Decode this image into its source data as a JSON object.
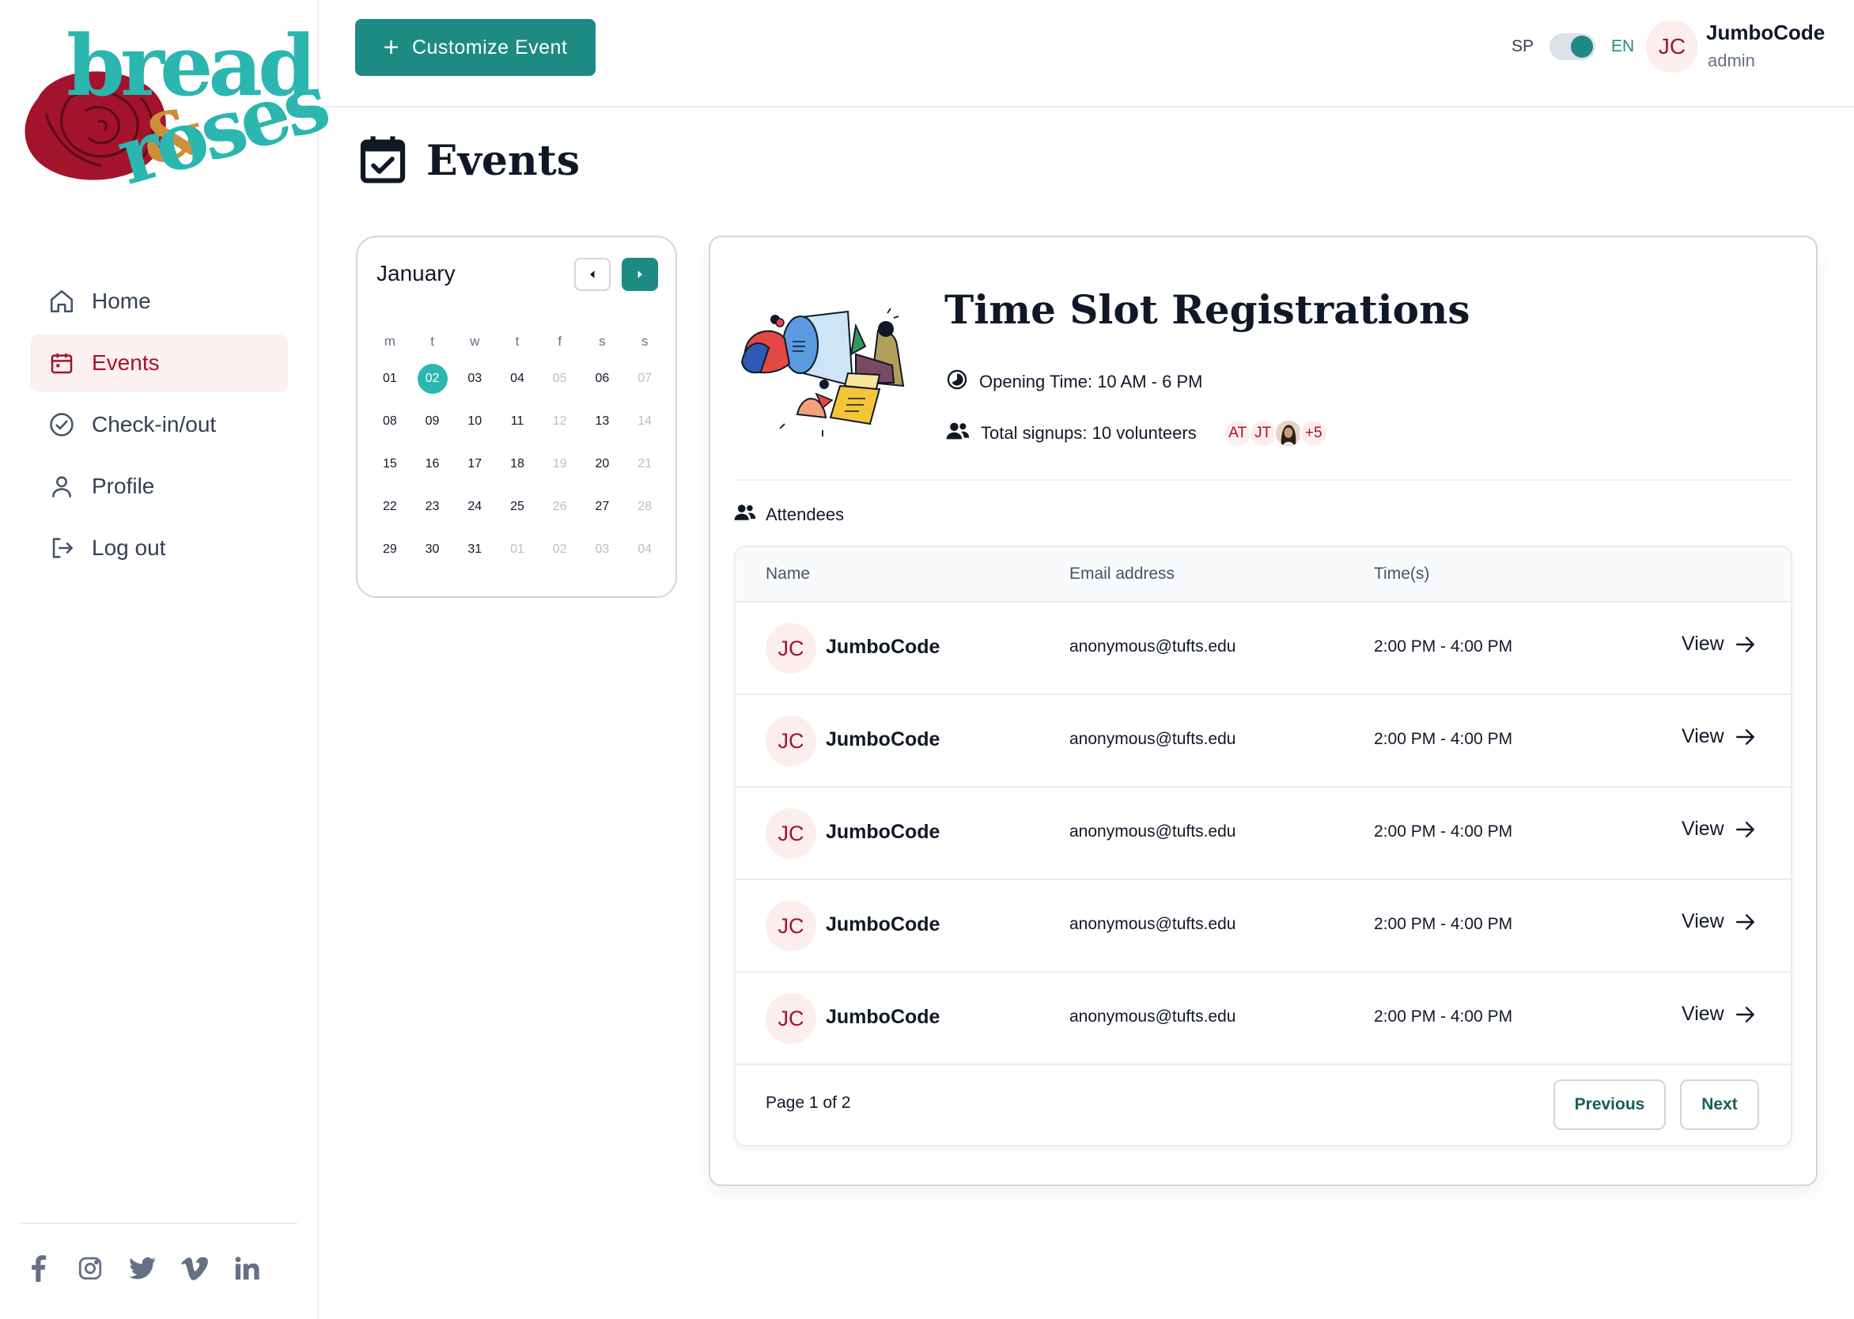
{
  "brand": {
    "logo_word1": "bread",
    "logo_amp": "&",
    "logo_word2": "roses",
    "colors": {
      "teal": "#2bb6b0",
      "dark_teal": "#1d8a84",
      "crimson": "#a3132c",
      "gold": "#d18e3a"
    }
  },
  "sidebar": {
    "items": [
      {
        "label": "Home",
        "icon": "home-icon",
        "active": false
      },
      {
        "label": "Events",
        "icon": "calendar-icon",
        "active": true
      },
      {
        "label": "Check-in/out",
        "icon": "check-circle-icon",
        "active": false
      },
      {
        "label": "Profile",
        "icon": "user-icon",
        "active": false
      },
      {
        "label": "Log out",
        "icon": "logout-icon",
        "active": false
      }
    ],
    "social": [
      "facebook-icon",
      "instagram-icon",
      "twitter-icon",
      "vimeo-icon",
      "linkedin-icon"
    ]
  },
  "header": {
    "customize_label": "Customize Event",
    "lang_left": "SP",
    "lang_right": "EN",
    "user_initials": "JC",
    "user_name": "JumboCode",
    "user_role": "admin"
  },
  "page": {
    "title": "Events"
  },
  "calendar": {
    "month": "January",
    "weekdays": [
      "m",
      "t",
      "w",
      "t",
      "f",
      "s",
      "s"
    ],
    "weeks": [
      [
        {
          "d": "01"
        },
        {
          "d": "02",
          "sel": true
        },
        {
          "d": "03"
        },
        {
          "d": "04"
        },
        {
          "d": "05",
          "m": true
        },
        {
          "d": "06"
        },
        {
          "d": "07",
          "m": true
        }
      ],
      [
        {
          "d": "08"
        },
        {
          "d": "09"
        },
        {
          "d": "10"
        },
        {
          "d": "11"
        },
        {
          "d": "12",
          "m": true
        },
        {
          "d": "13"
        },
        {
          "d": "14",
          "m": true
        }
      ],
      [
        {
          "d": "15"
        },
        {
          "d": "16"
        },
        {
          "d": "17"
        },
        {
          "d": "18"
        },
        {
          "d": "19",
          "m": true
        },
        {
          "d": "20"
        },
        {
          "d": "21",
          "m": true
        }
      ],
      [
        {
          "d": "22"
        },
        {
          "d": "23"
        },
        {
          "d": "24"
        },
        {
          "d": "25"
        },
        {
          "d": "26",
          "m": true
        },
        {
          "d": "27"
        },
        {
          "d": "28",
          "m": true
        }
      ],
      [
        {
          "d": "29"
        },
        {
          "d": "30"
        },
        {
          "d": "31"
        },
        {
          "d": "01",
          "m": true
        },
        {
          "d": "02",
          "m": true
        },
        {
          "d": "03",
          "m": true
        },
        {
          "d": "04",
          "m": true
        }
      ]
    ]
  },
  "event": {
    "title": "Time Slot Registrations",
    "opening_time": "Opening Time: 10 AM - 6 PM",
    "total_signups": "Total signups: 10 volunteers",
    "avatar_1": "AT",
    "avatar_2": "JT",
    "avatar_more": "+5",
    "attendees_label": "Attendees"
  },
  "table": {
    "headers": {
      "name": "Name",
      "email": "Email address",
      "times": "Time(s)"
    },
    "rows": [
      {
        "initials": "JC",
        "name": "JumboCode",
        "email": "anonymous@tufts.edu",
        "time": "2:00 PM - 4:00 PM",
        "action": "View"
      },
      {
        "initials": "JC",
        "name": "JumboCode",
        "email": "anonymous@tufts.edu",
        "time": "2:00 PM - 4:00 PM",
        "action": "View"
      },
      {
        "initials": "JC",
        "name": "JumboCode",
        "email": "anonymous@tufts.edu",
        "time": "2:00 PM - 4:00 PM",
        "action": "View"
      },
      {
        "initials": "JC",
        "name": "JumboCode",
        "email": "anonymous@tufts.edu",
        "time": "2:00 PM - 4:00 PM",
        "action": "View"
      },
      {
        "initials": "JC",
        "name": "JumboCode",
        "email": "anonymous@tufts.edu",
        "time": "2:00 PM - 4:00 PM",
        "action": "View"
      }
    ],
    "page_info": "Page 1 of 2",
    "prev_label": "Previous",
    "next_label": "Next"
  }
}
